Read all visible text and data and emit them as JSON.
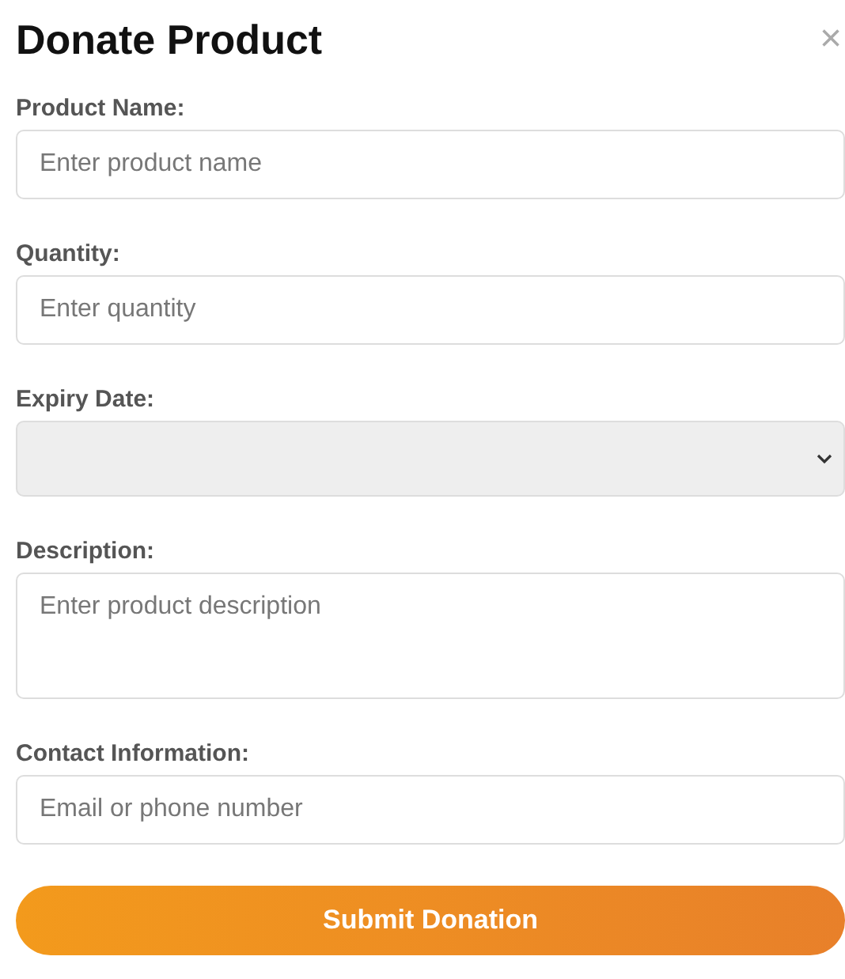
{
  "title": "Donate Product",
  "close": "×",
  "fields": [
    {
      "kind": "input",
      "label": "Product Name:",
      "placeholder": "Enter product name"
    },
    {
      "kind": "input",
      "label": "Quantity:",
      "placeholder": "Enter quantity"
    },
    {
      "kind": "select",
      "label": "Expiry Date:"
    },
    {
      "kind": "textarea",
      "label": "Description:",
      "placeholder": "Enter product description"
    },
    {
      "kind": "input",
      "label": "Contact Information:",
      "placeholder": "Email or phone number"
    }
  ],
  "submit": "Submit Donation"
}
